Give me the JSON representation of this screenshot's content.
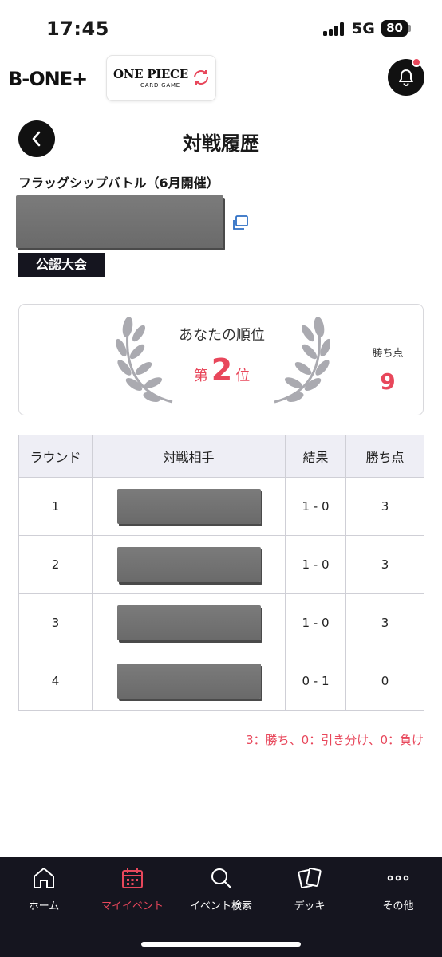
{
  "status_bar": {
    "time": "17:45",
    "network": "5G",
    "battery": "80"
  },
  "header": {
    "brand": "B-ONE+",
    "game_logo_title": "ONE PIECE",
    "game_logo_subtitle": "CARD GAME"
  },
  "page": {
    "title": "対戦履歴"
  },
  "event": {
    "name": "フラッグシップバトル（6月開催）",
    "badge": "公認大会"
  },
  "rank": {
    "label": "あなたの順位",
    "prefix": "第",
    "number": "2",
    "suffix": "位",
    "points_label": "勝ち点",
    "points_value": "9"
  },
  "table": {
    "headers": [
      "ラウンド",
      "対戦相手",
      "結果",
      "勝ち点"
    ],
    "rows": [
      {
        "round": "1",
        "result": "1 - 0",
        "points": "3"
      },
      {
        "round": "2",
        "result": "1 - 0",
        "points": "3"
      },
      {
        "round": "3",
        "result": "1 - 0",
        "points": "3"
      },
      {
        "round": "4",
        "result": "0 - 1",
        "points": "0"
      }
    ]
  },
  "legend": "3：勝ち、0：引き分け、0：負け",
  "bottom_nav": [
    {
      "label": "ホーム",
      "icon": "home-icon"
    },
    {
      "label": "マイイベント",
      "icon": "calendar-icon",
      "active": true
    },
    {
      "label": "イベント検索",
      "icon": "search-icon"
    },
    {
      "label": "デッキ",
      "icon": "cards-icon"
    },
    {
      "label": "その他",
      "icon": "more-icon"
    }
  ],
  "colors": {
    "accent": "#e8475b",
    "dark": "#15151f",
    "table_header_bg": "#eeeef5"
  }
}
